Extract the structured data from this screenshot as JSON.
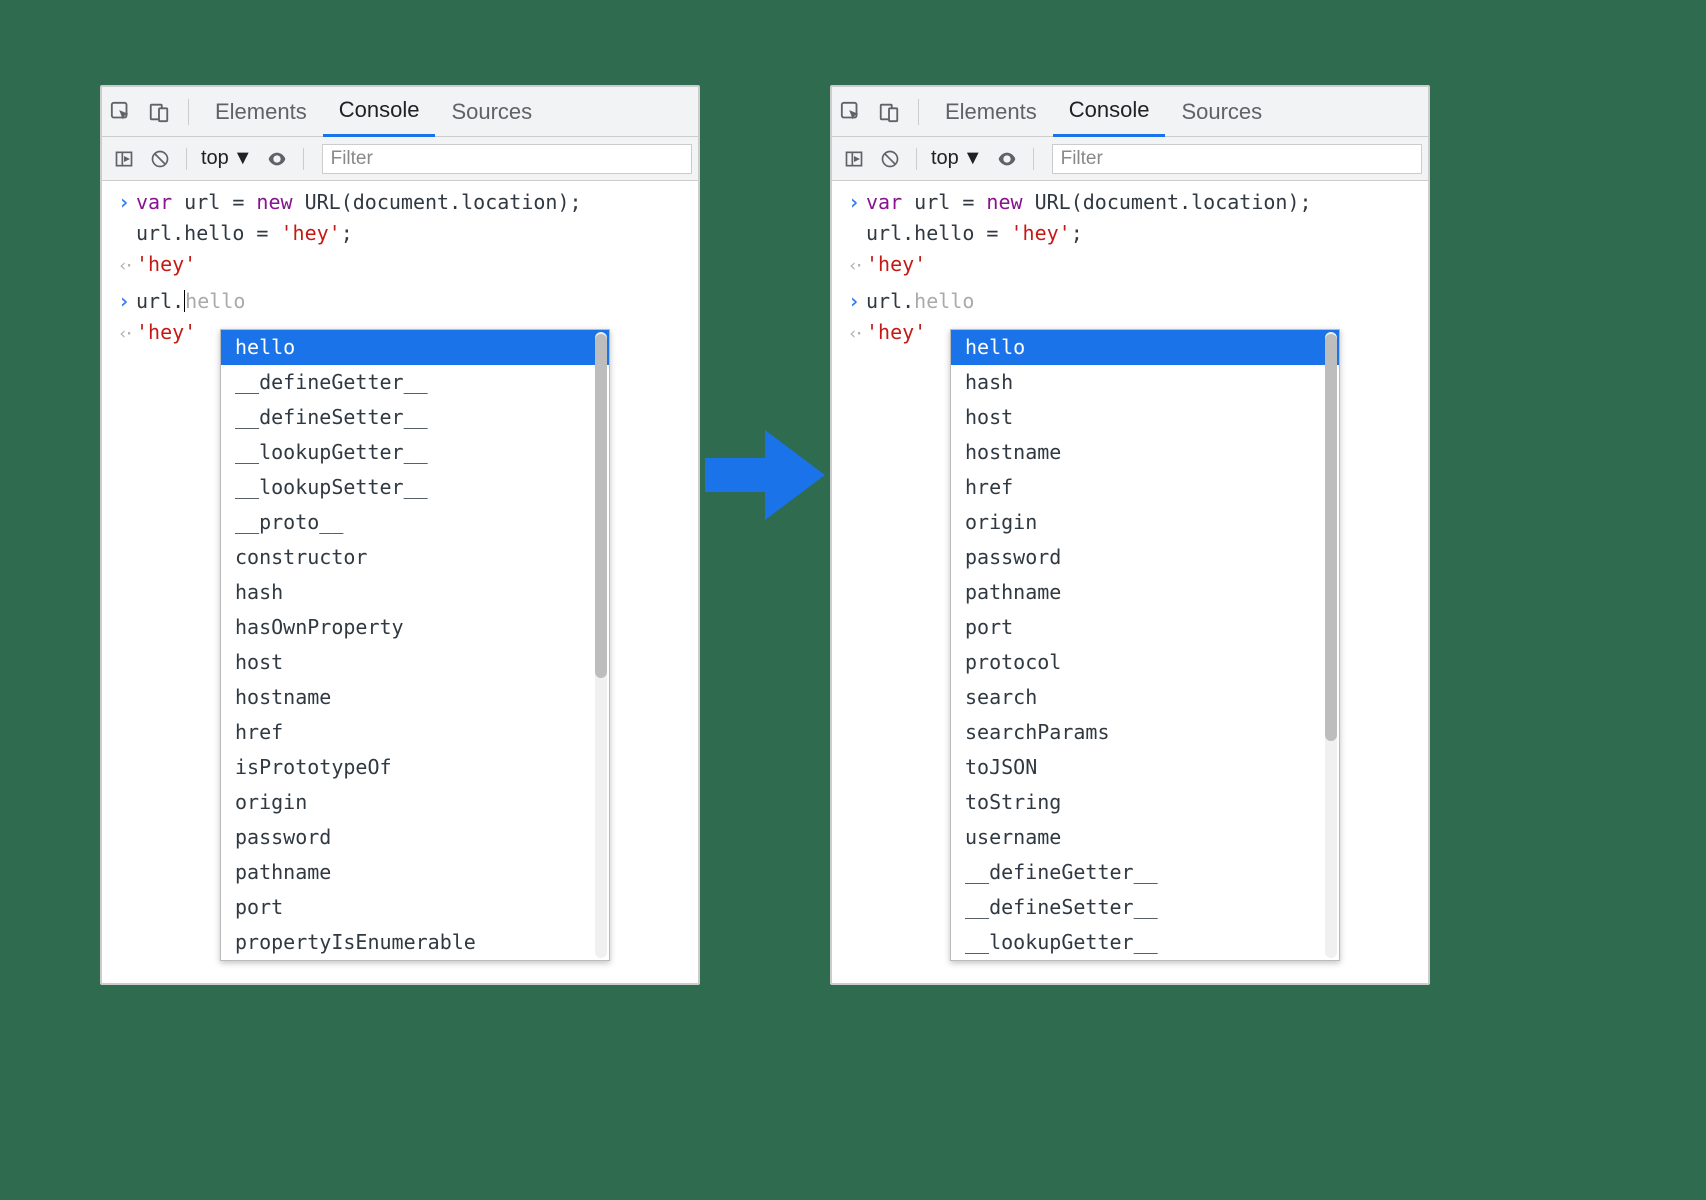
{
  "tabs": {
    "elements": "Elements",
    "console": "Console",
    "sources": "Sources"
  },
  "toolbar": {
    "context": "top",
    "filter_placeholder": "Filter"
  },
  "console": {
    "line1_pre": "var",
    "line1_mid": " url = ",
    "line1_new": "new",
    "line1_post": " URL(document.location);",
    "line2": "url.hello = ",
    "line2_str": "'hey'",
    "line2_end": ";",
    "result_str": "'hey'",
    "prompt_pre": "url.",
    "prompt_ghost": "hello",
    "prompt_left_caret": "url.",
    "out2_str": "'hey'"
  },
  "ac_left": [
    "hello",
    "__defineGetter__",
    "__defineSetter__",
    "__lookupGetter__",
    "__lookupSetter__",
    "__proto__",
    "constructor",
    "hash",
    "hasOwnProperty",
    "host",
    "hostname",
    "href",
    "isPrototypeOf",
    "origin",
    "password",
    "pathname",
    "port",
    "propertyIsEnumerable"
  ],
  "ac_right": [
    "hello",
    "hash",
    "host",
    "hostname",
    "href",
    "origin",
    "password",
    "pathname",
    "port",
    "protocol",
    "search",
    "searchParams",
    "toJSON",
    "toString",
    "username",
    "__defineGetter__",
    "__defineSetter__",
    "__lookupGetter__"
  ]
}
